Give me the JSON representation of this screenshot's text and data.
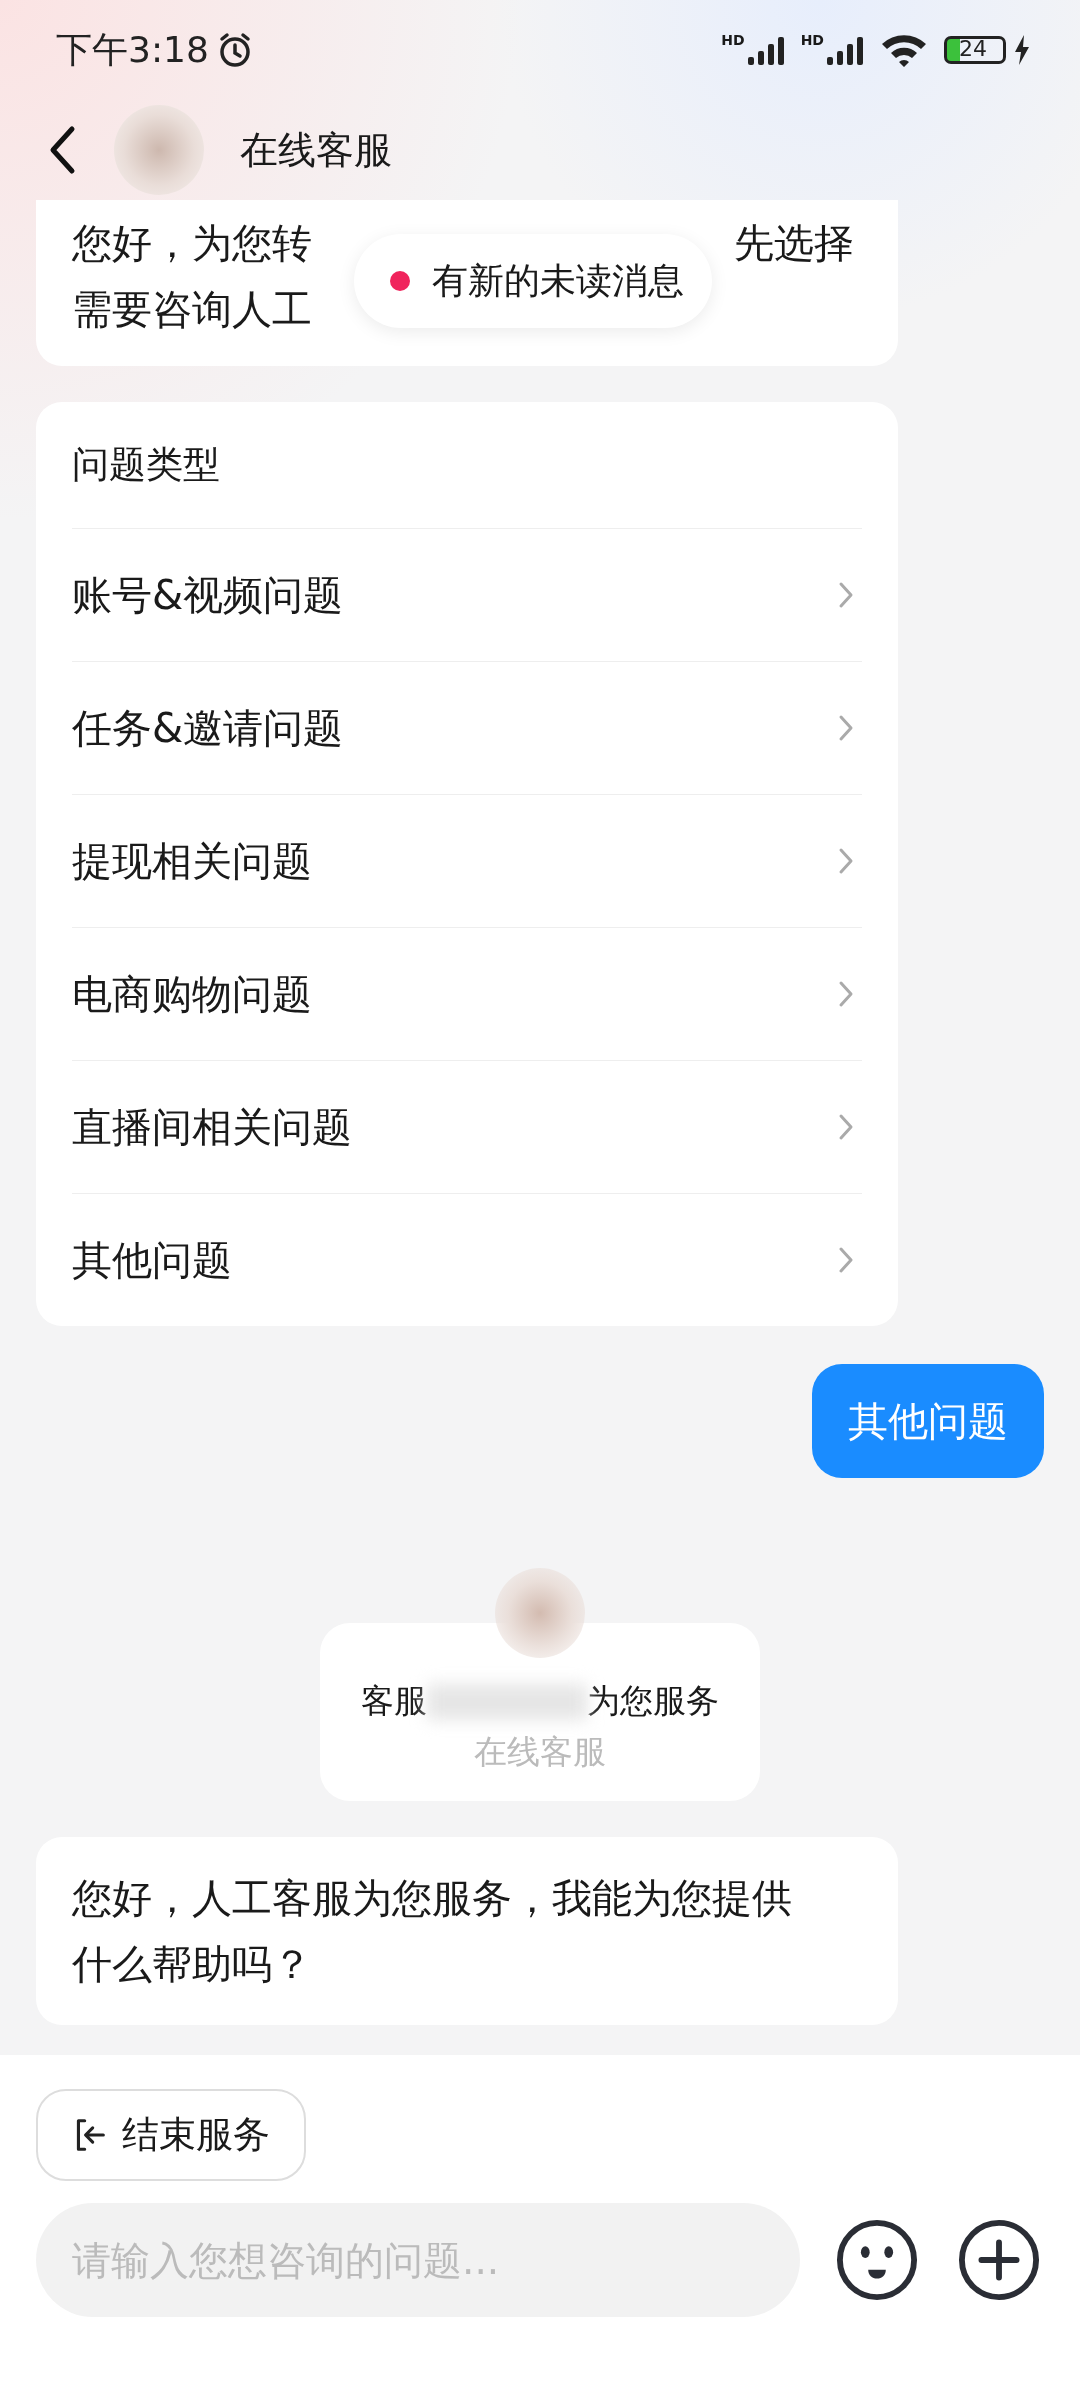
{
  "status_bar": {
    "time": "下午3:18",
    "signal_labels": [
      "HD",
      "HD"
    ],
    "battery": "24"
  },
  "header": {
    "title": "在线客服"
  },
  "toast": {
    "text": "有新的未读消息"
  },
  "messages": [
    {
      "kind": "partial",
      "lines": [
        {
          "left": "您好，为您转",
          "right": "先选择"
        },
        {
          "left": "需要咨询人工"
        }
      ]
    },
    {
      "kind": "options",
      "title": "问题类型",
      "items": [
        "账号&视频问题",
        "任务&邀请问题",
        "提现相关问题",
        "电商购物问题",
        "直播间相关问题",
        "其他问题"
      ]
    },
    {
      "kind": "user",
      "text": "其他问题"
    },
    {
      "kind": "agent",
      "left": "客服",
      "right": "为您服务",
      "subtitle": "在线客服"
    },
    {
      "kind": "text",
      "text": "您好，人工客服为您服务，我能为您提供什么帮助吗？"
    }
  ],
  "end_button": {
    "label": "结束服务"
  },
  "input": {
    "placeholder": "请输入您想咨询的问题..."
  }
}
